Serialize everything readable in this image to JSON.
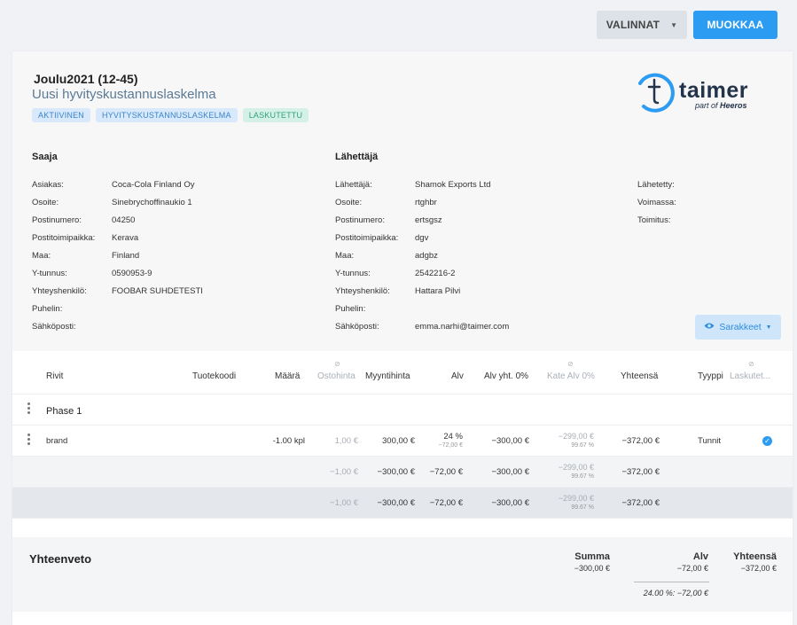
{
  "toolbar": {
    "valinnat": "VALINNAT",
    "muokkaa": "MUOKKAA"
  },
  "header": {
    "title": "Joulu2021 (12-45)",
    "subtitle": "Uusi hyvityskustannuslaskelma",
    "tags": [
      "AKTIIVINEN",
      "HYVITYSKUSTANNUSLASKELMA",
      "LASKUTETTU"
    ]
  },
  "logo": {
    "word": "taimer",
    "part_of": "part of",
    "brand": "Heeros"
  },
  "saaja": {
    "title": "Saaja",
    "rows": [
      {
        "label": "Asiakas:",
        "value": "Coca-Cola Finland Oy"
      },
      {
        "label": "Osoite:",
        "value": "Sinebrychoffinaukio 1"
      },
      {
        "label": "Postinumero:",
        "value": "04250"
      },
      {
        "label": "Postitoimipaikka:",
        "value": "Kerava"
      },
      {
        "label": "Maa:",
        "value": "Finland"
      },
      {
        "label": "Y-tunnus:",
        "value": "0590953-9"
      },
      {
        "label": "Yhteyshenkilö:",
        "value": "FOOBAR SUHDETESTI"
      },
      {
        "label": "Puhelin:",
        "value": ""
      },
      {
        "label": "Sähköposti:",
        "value": ""
      }
    ]
  },
  "lahettaja": {
    "title": "Lähettäjä",
    "rows": [
      {
        "label": "Lähettäjä:",
        "value": "Shamok Exports Ltd"
      },
      {
        "label": "Osoite:",
        "value": "rtghbr"
      },
      {
        "label": "Postinumero:",
        "value": "ertsgsz"
      },
      {
        "label": "Postitoimipaikka:",
        "value": "dgv"
      },
      {
        "label": "Maa:",
        "value": "adgbz"
      },
      {
        "label": "Y-tunnus:",
        "value": "2542216-2"
      },
      {
        "label": "Yhteyshenkilö:",
        "value": "Hattara Pilvi"
      },
      {
        "label": "Puhelin:",
        "value": ""
      },
      {
        "label": "Sähköposti:",
        "value": "emma.narhi@taimer.com"
      }
    ]
  },
  "meta": {
    "rows": [
      {
        "label": "Lähetetty:",
        "value": ""
      },
      {
        "label": "Voimassa:",
        "value": ""
      },
      {
        "label": "Toimitus:",
        "value": ""
      }
    ]
  },
  "sarakkeet": "Sarakkeet",
  "table": {
    "headers": {
      "rivit": "Rivit",
      "tuotekoodi": "Tuotekoodi",
      "maara": "Määrä",
      "ostohinta": "Ostohinta",
      "myyntihinta": "Myyntihinta",
      "alv": "Alv",
      "alv_yht": "Alv yht. 0%",
      "kate_alv": "Kate Alv 0%",
      "yhteensa": "Yhteensä",
      "tyyppi": "Tyyppi",
      "laskutettu": "Laskutet..."
    },
    "phase": "Phase 1",
    "row": {
      "name": "brand",
      "maara": "-1.00 kpl",
      "ostohinta": "1,00 €",
      "myyntihinta": "300,00 €",
      "alv_pct": "24 %",
      "alv_sub": "−72,00 €",
      "alv_yht": "−300,00 €",
      "kate": "−299,00 €",
      "kate_pct": "99.67 %",
      "yhteensa": "−372,00 €",
      "tyyppi": "Tunnit"
    },
    "subtotal": {
      "ostohinta": "−1,00 €",
      "myyntihinta": "−300,00 €",
      "alv": "−72,00 €",
      "alv_yht": "−300,00 €",
      "kate": "−299,00 €",
      "kate_pct": "99.67 %",
      "yhteensa": "−372,00 €"
    },
    "total": {
      "ostohinta": "−1,00 €",
      "myyntihinta": "−300,00 €",
      "alv": "−72,00 €",
      "alv_yht": "−300,00 €",
      "kate": "−299,00 €",
      "kate_pct": "99.67 %",
      "yhteensa": "−372,00 €"
    }
  },
  "summary": {
    "title": "Yhteenveto",
    "summa_label": "Summa",
    "summa": "−300,00 €",
    "alv_label": "Alv",
    "alv": "−72,00 €",
    "yhteensa_label": "Yhteensä",
    "yhteensa": "−372,00 €",
    "alv_breakdown": "24.00 %:  −72,00 €"
  }
}
